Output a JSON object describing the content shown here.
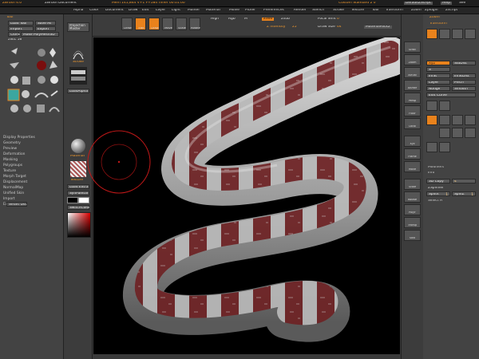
{
  "titlebar": {
    "app": "ZBrush 4.0",
    "document": "ZBrush Document",
    "mem": "Mem 141,844  V+1  F+584",
    "time": "Timer 00:01:00",
    "right_label": "Custom  Standard 2  0",
    "script_label": "DefaultZScript",
    "help": "Help",
    "see": "See"
  },
  "menu": [
    "Alpha",
    "Color",
    "Document",
    "Draw",
    "Edit",
    "Layer",
    "Light",
    "Marker",
    "Material",
    "Movie",
    "Picker",
    "Preferences",
    "Render",
    "Stencil",
    "Stroke",
    "Texture",
    "Tool",
    "Transform",
    "Zoom",
    "Zplugin",
    "Zscript"
  ],
  "left": {
    "header": "Tool",
    "load_tool": "Load Tool",
    "save_as": "Save As",
    "import": "Import",
    "export": "Export",
    "clone": "Clone",
    "make_polymesh": "Make PolyMesh3D",
    "zsel": "zSEL 58",
    "sections": [
      "Display Properties",
      "Geometry",
      "Preview",
      "Deformation",
      "Masking",
      "Polygroups",
      "Texture",
      "Morph Target",
      "Displacement",
      "NormalMap",
      "Unified Skin",
      "Import",
      "Export"
    ],
    "smart_dsc": "Smart Dsc"
  },
  "shelf_left": {
    "projection_master": "Projection Master",
    "stroke_label": "Stroke",
    "alpha_label": "LoadAlpha",
    "material_label": "Material",
    "texture_label": "Texture",
    "load_extra": "Load Extra",
    "synpalette": "SynPalette",
    "switch_color": "SwitchColor"
  },
  "topshelf": {
    "tools": [
      {
        "label": "Draw",
        "active": false
      },
      {
        "label": "Edit",
        "active": true
      },
      {
        "label": "Draw",
        "active": true
      },
      {
        "label": "Move",
        "active": false
      },
      {
        "label": "Scale",
        "active": false
      },
      {
        "label": "Rotate",
        "active": false
      }
    ],
    "mrgb": "Mrgb",
    "rgb": "Rgb",
    "m": "M",
    "zadd": "Zadd",
    "zsub": "Zsub",
    "zcut": "Zcut",
    "focal_shift_label": "Focal Shift",
    "focal_shift_value": "0",
    "draw_size_label": "Draw Size",
    "draw_size_value": "64",
    "z_intensity_label": "Z Intensity",
    "z_intensity_value": "25",
    "material_name": "MaterialPack2",
    "high": "High"
  },
  "rightshelf": {
    "buttons": [
      "Scroll",
      "Zoom",
      "Actual",
      "AAHalf",
      "Persp",
      "Floor",
      "Local",
      "Xyz",
      "Frame",
      "Move",
      "Scale",
      "Rotate",
      "PolyF",
      "Transp",
      "Solo"
    ]
  },
  "right": {
    "header": "Zoom",
    "transform": "Transform",
    "xyz": "Xyz",
    "stdist": "StdDist",
    "s_label": "S",
    "infst": "InfSt",
    "infsdist": "InfStDist",
    "layer": "Layer",
    "pinch": "Pinch",
    "nudge": "Nudge",
    "smooth": "Smooth",
    "edit_curve": "Edit Curve",
    "sections": [
      "Modifiers",
      "Info"
    ],
    "sd_copy": "3D Copy",
    "sd_value": "4",
    "zspinner": "ZSpinner",
    "spin3": "SpinX",
    "spin3_val": "1",
    "spinz": "SpinZ",
    "spinz_val": "1",
    "select_fi": "Select Fi"
  },
  "colors": {
    "accent": "#e9821c",
    "panel": "#434343",
    "viewport": "#000000",
    "snake_red": "#6e2224",
    "snake_white": "#b9b9b9"
  }
}
